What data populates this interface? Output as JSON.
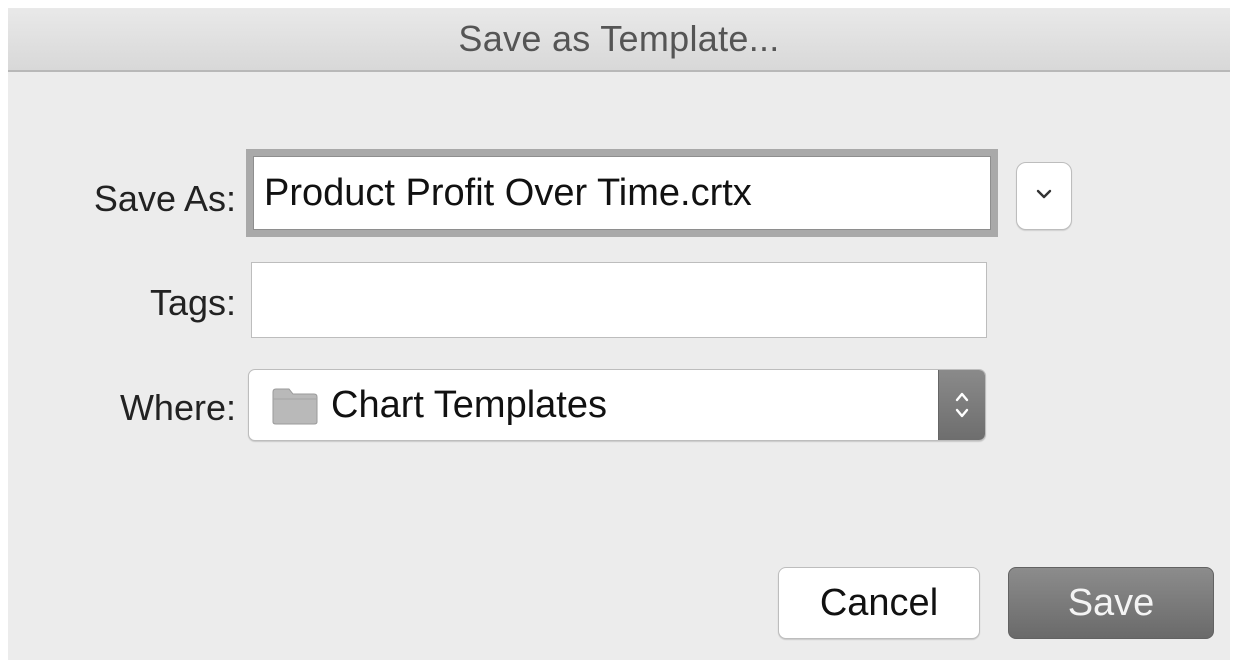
{
  "dialog": {
    "title": "Save as Template..."
  },
  "form": {
    "save_as_label": "Save As:",
    "save_as_value": "Product Profit Over Time.crtx",
    "tags_label": "Tags:",
    "tags_value": "",
    "where_label": "Where:",
    "where_value": "Chart Templates"
  },
  "icons": {
    "expand": "chevron-down-icon",
    "folder": "folder-icon",
    "stepper": "up-down-arrows-icon"
  },
  "buttons": {
    "cancel_label": "Cancel",
    "save_label": "Save"
  },
  "colors": {
    "dialog_background": "#ececec",
    "default_button": "#7a7a7a",
    "folder": "#b9b9b9"
  }
}
